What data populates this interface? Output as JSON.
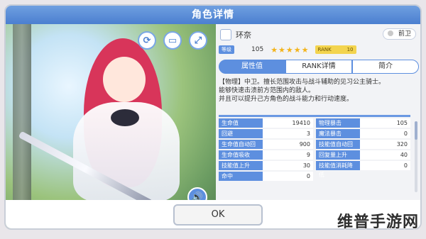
{
  "window": {
    "title": "角色详情"
  },
  "character": {
    "name": "环奈",
    "role": "前卫",
    "level_label": "等级",
    "level": "105",
    "stars": "★★★★★",
    "rank_label": "RANK",
    "rank_value": "10"
  },
  "tabs": [
    {
      "label": "属性值",
      "active": true
    },
    {
      "label": "RANK详情",
      "active": false
    },
    {
      "label": "简介",
      "active": false
    }
  ],
  "description": {
    "line1": "【物理】中卫。擅长范围攻击与战斗辅助的见习公主骑士。",
    "line2": "能够快速击溃前方范围内的敌人。",
    "line3": "并且可以提升己方角色的战斗能力和行动速度。"
  },
  "stats": [
    {
      "k": "生命值",
      "v": "19410"
    },
    {
      "k": "物理暴击",
      "v": "105"
    },
    {
      "k": "回避",
      "v": "3"
    },
    {
      "k": "魔法暴击",
      "v": "0"
    },
    {
      "k": "生命值自动回复",
      "v": "900"
    },
    {
      "k": "技能值自动回复",
      "v": "320"
    },
    {
      "k": "生命值吸收",
      "v": "9"
    },
    {
      "k": "回复量上升",
      "v": "40"
    },
    {
      "k": "技能值上升",
      "v": "30"
    },
    {
      "k": "技能值消耗降低",
      "v": "0"
    },
    {
      "k": "命中",
      "v": "0"
    }
  ],
  "buttons": {
    "ok": "OK"
  },
  "watermark": "维普手游网",
  "icons": {
    "rotate": "rotate-icon",
    "card": "card-icon",
    "expand": "expand-icon",
    "voice": "speaker-icon"
  },
  "colors": {
    "accent": "#5d8fdf",
    "title_bar": "#4b7fd0",
    "star": "#f3b41c",
    "rank": "#f3d44f"
  }
}
